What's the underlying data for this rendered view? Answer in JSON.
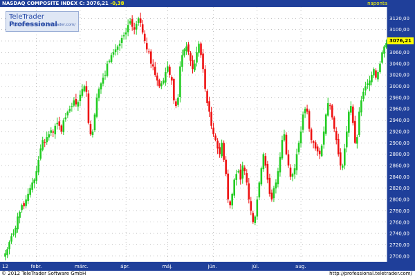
{
  "header": {
    "title": "NASDAQ COMPOSITE INDEX",
    "close_label": "C: 3076,21",
    "change": "-0,38",
    "period": "naponta"
  },
  "logo": {
    "brand_a": "TeleTrader ",
    "brand_b": "Professional",
    "url": "http://professional.teletrader.com/"
  },
  "last_value": "3076,21",
  "footer": {
    "copyright": "© 2012 TeleTrader Software GmbH",
    "url": "http://professional.teletrader.com/"
  },
  "colors": {
    "up": "#22cc22",
    "down": "#ee1111",
    "header_bg": "#1f3f9a",
    "axis_bg": "#1f3f9a",
    "highlight": "#ffff00"
  },
  "chart_data": {
    "type": "candlestick",
    "title": "NASDAQ COMPOSITE INDEX",
    "ylim": [
      2690,
      3140
    ],
    "y_ticks": [
      2700,
      2720,
      2740,
      2760,
      2780,
      2800,
      2820,
      2840,
      2860,
      2880,
      2900,
      2920,
      2940,
      2960,
      2980,
      3000,
      3020,
      3040,
      3060,
      3080,
      3100,
      3120
    ],
    "y_tick_labels": [
      "2700,00",
      "2720,00",
      "2740,00",
      "2760,00",
      "2780,00",
      "2800,00",
      "2820,00",
      "2840,00",
      "2860,00",
      "2880,00",
      "2900,00",
      "2920,00",
      "2940,00",
      "2960,00",
      "2980,00",
      "3000,00",
      "3020,00",
      "3040,00",
      "3060,00",
      "3080,00",
      "3100,00",
      "3120,00"
    ],
    "x_labels": [
      "12",
      "febr.",
      "márc.",
      "ápr.",
      "máj.",
      "jún.",
      "júl.",
      "aug."
    ],
    "x_label_positions": [
      0,
      15,
      36,
      58,
      78,
      100,
      121,
      142
    ],
    "grid": true,
    "legend": "none",
    "closes": [
      2705,
      2712,
      2725,
      2735,
      2740,
      2750,
      2770,
      2778,
      2790,
      2788,
      2800,
      2810,
      2820,
      2830,
      2835,
      2850,
      2870,
      2890,
      2905,
      2900,
      2910,
      2915,
      2922,
      2918,
      2930,
      2935,
      2930,
      2920,
      2940,
      2945,
      2955,
      2960,
      2965,
      2975,
      2968,
      2972,
      2985,
      2995,
      3000,
      2990,
      2935,
      2915,
      2920,
      2950,
      2980,
      2995,
      3005,
      3015,
      3020,
      3040,
      3045,
      3055,
      3060,
      3065,
      3070,
      3075,
      3085,
      3090,
      3095,
      3108,
      3115,
      3105,
      3100,
      3110,
      3120,
      3112,
      3095,
      3080,
      3065,
      3060,
      3040,
      3035,
      3020,
      3010,
      3000,
      3005,
      3010,
      3025,
      3035,
      3020,
      3010,
      2975,
      2965,
      2980,
      3035,
      3055,
      3065,
      3070,
      3060,
      3045,
      3030,
      3040,
      3060,
      3075,
      3055,
      3030,
      2995,
      2970,
      2955,
      2930,
      2915,
      2905,
      2890,
      2880,
      2900,
      2870,
      2845,
      2800,
      2790,
      2810,
      2835,
      2845,
      2850,
      2835,
      2860,
      2850,
      2830,
      2800,
      2780,
      2760,
      2770,
      2800,
      2830,
      2855,
      2880,
      2860,
      2835,
      2810,
      2800,
      2820,
      2830,
      2850,
      2875,
      2905,
      2915,
      2880,
      2860,
      2840,
      2845,
      2855,
      2880,
      2900,
      2920,
      2950,
      2960,
      2955,
      2925,
      2905,
      2900,
      2890,
      2885,
      2880,
      2895,
      2920,
      2950,
      2970,
      2965,
      2945,
      2925,
      2905,
      2880,
      2860,
      2860,
      2890,
      2920,
      2955,
      2965,
      2935,
      2900,
      2910,
      2955,
      2975,
      2990,
      3000,
      3005,
      3010,
      3020,
      3030,
      3015,
      3025,
      3040,
      3060,
      3070,
      3076.21
    ]
  }
}
